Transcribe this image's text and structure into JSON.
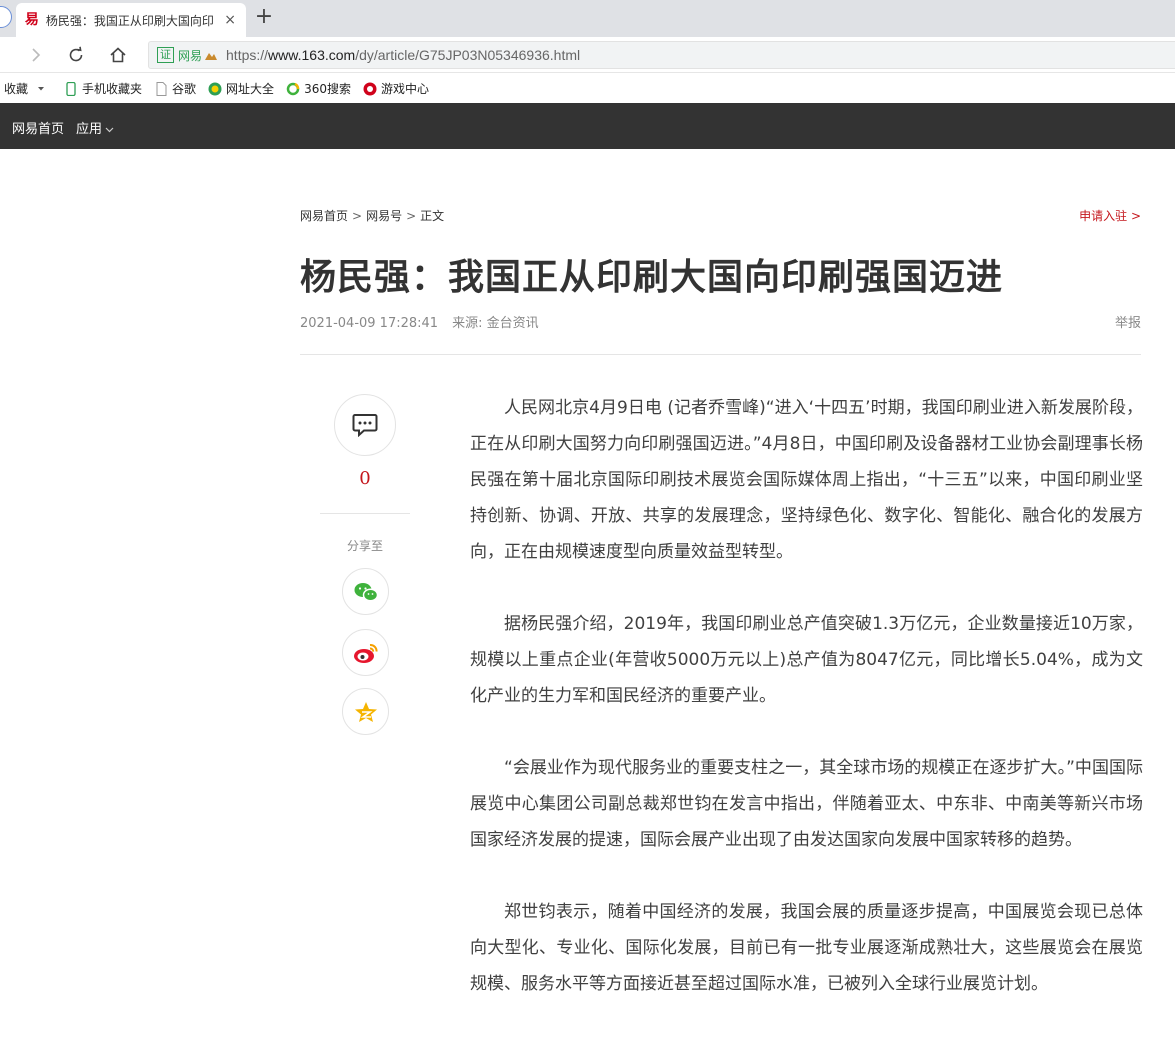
{
  "browser": {
    "tab_title": "杨民强：我国正从印刷大国向印",
    "tab_favicon": "易",
    "tab_close": "×",
    "new_tab": "+",
    "cert_badge": "证",
    "cert_label": "网易",
    "url_prefix": "https://",
    "url_host": "www.163.com",
    "url_path": "/dy/article/G75JP03N05346936.html"
  },
  "bookmarks": [
    {
      "label": "收藏",
      "icon": "dropdown-icon"
    },
    {
      "label": "手机收藏夹",
      "icon": "phone-icon"
    },
    {
      "label": "谷歌",
      "icon": "page-icon"
    },
    {
      "label": "网址大全",
      "icon": "hao-icon"
    },
    {
      "label": "360搜索",
      "icon": "search-360-icon"
    },
    {
      "label": "游戏中心",
      "icon": "game-icon"
    }
  ],
  "sitenav": {
    "home": "网易首页",
    "apps": "应用"
  },
  "article": {
    "breadcrumb": [
      "网易首页",
      "网易号",
      "正文"
    ],
    "breadcrumb_sep": ">",
    "apply": "申请入驻 >",
    "title": "杨民强：我国正从印刷大国向印刷强国迈进",
    "datetime": "2021-04-09 17:28:41",
    "source": "来源: 金台资讯",
    "report": "举报",
    "comment_count": "0",
    "share_label": "分享至",
    "paragraphs": [
      "人民网北京4月9日电 (记者乔雪峰)“进入‘十四五’时期，我国印刷业进入新发展阶段，正在从印刷大国努力向印刷强国迈进。”4月8日，中国印刷及设备器材工业协会副理事长杨民强在第十届北京国际印刷技术展览会国际媒体周上指出，“十三五”以来，中国印刷业坚持创新、协调、开放、共享的发展理念，坚持绿色化、数字化、智能化、融合化的发展方向，正在由规模速度型向质量效益型转型。",
      "据杨民强介绍，2019年，我国印刷业总产值突破1.3万亿元，企业数量接近10万家，规模以上重点企业(年营收5000万元以上)总产值为8047亿元，同比增长5.04%，成为文化产业的生力军和国民经济的重要产业。",
      "“会展业作为现代服务业的重要支柱之一，其全球市场的规模正在逐步扩大。”中国国际展览中心集团公司副总裁郑世钧在发言中指出，伴随着亚太、中东非、中南美等新兴市场国家经济发展的提速，国际会展产业出现了由发达国家向发展中国家转移的趋势。",
      "郑世钧表示，随着中国经济的发展，我国会展的质量逐步提高，中国展览会现已总体向大型化、专业化、国际化发展，目前已有一批专业展逐渐成熟壮大，这些展览会在展览规模、服务水平等方面接近甚至超过国际水准，已被列入全球行业展览计划。"
    ]
  },
  "colors": {
    "accent_red": "#c4161c",
    "site_bar": "#333333",
    "wechat_green": "#3fb23c",
    "weibo_red": "#e6162d",
    "qzone_yellow": "#f5b400"
  }
}
